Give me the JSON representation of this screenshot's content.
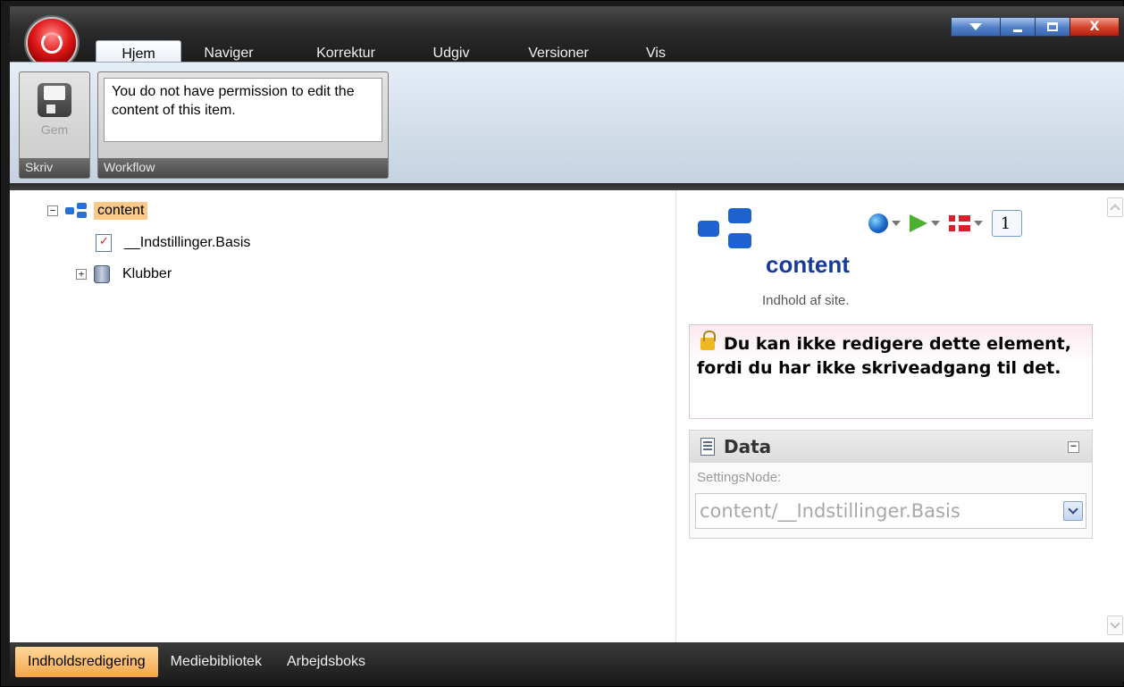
{
  "ribbon_tabs": [
    "Hjem",
    "Naviger",
    "Korrektur",
    "Udgiv",
    "Versioner",
    "Vis"
  ],
  "active_tab": "Hjem",
  "ribbon": {
    "skriv_group_label": "Skriv",
    "save_label": "Gem",
    "workflow_group_label": "Workflow",
    "workflow_message": "You do not have permission to edit the content of this item."
  },
  "tree": {
    "root_label": "content",
    "children": [
      "__Indstillinger.Basis",
      "Klubber"
    ]
  },
  "details": {
    "title": "content",
    "description": "Indhold af site.",
    "version": "1",
    "warning": "Du kan ikke redigere dette element, fordi du har ikke skriveadgang til det.",
    "section_title": "Data",
    "field_label": "SettingsNode:",
    "field_value": "content/__Indstillinger.Basis"
  },
  "bottom_nav": [
    "Indholdsredigering",
    "Mediebibliotek",
    "Arbejdsboks"
  ],
  "colors": {
    "selection": "#f9c98a",
    "title_blue": "#1a3a9a",
    "active_bottom": "#f4a64a"
  },
  "icons": [
    "app-orb-icon",
    "save-icon",
    "tree-icon",
    "checklist-doc-icon",
    "database-icon",
    "globe-icon",
    "green-flag-icon",
    "danish-flag-icon",
    "lock-icon",
    "data-doc-icon"
  ]
}
